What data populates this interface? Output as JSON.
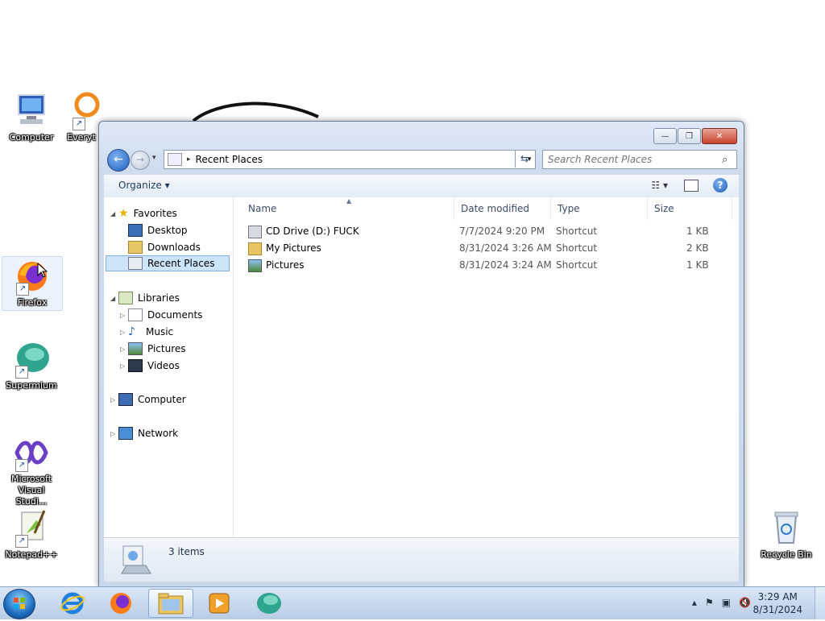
{
  "desktop": {
    "icons": [
      {
        "label": "Computer"
      },
      {
        "label": "Everyt"
      },
      {
        "label": "Firefox"
      },
      {
        "label": "Supermium"
      },
      {
        "label": "Microsoft Visual Studi..."
      },
      {
        "label": "Notepad++"
      },
      {
        "label": "Recycle Bin"
      }
    ]
  },
  "window": {
    "caption_buttons": {
      "minimize": "—",
      "maximize": "❐",
      "close": "✕"
    },
    "nav": {
      "back": "←",
      "forward": "→",
      "history": "▾"
    },
    "address": {
      "path": "Recent Places",
      "separator": "▸",
      "dropdown": "▾",
      "refresh": "⇆"
    },
    "search": {
      "placeholder": "Search Recent Places"
    },
    "commandbar": {
      "organize": "Organize ▾",
      "views": "☷ ▾",
      "help": "?"
    },
    "navpane": {
      "favorites": "Favorites",
      "desktop": "Desktop",
      "downloads": "Downloads",
      "recent_places": "Recent Places",
      "libraries": "Libraries",
      "documents": "Documents",
      "music": "Music",
      "pictures": "Pictures",
      "videos": "Videos",
      "computer": "Computer",
      "network": "Network"
    },
    "columns": {
      "name": "Name",
      "date_modified": "Date modified",
      "type": "Type",
      "size": "Size"
    },
    "files": [
      {
        "name": "CD Drive (D:) FUCK",
        "date": "7/7/2024 9:20 PM",
        "type": "Shortcut",
        "size": "1 KB"
      },
      {
        "name": "My Pictures",
        "date": "8/31/2024 3:26 AM",
        "type": "Shortcut",
        "size": "2 KB"
      },
      {
        "name": "Pictures",
        "date": "8/31/2024 3:24 AM",
        "type": "Shortcut",
        "size": "1 KB"
      }
    ],
    "status": {
      "items": "3 items"
    }
  },
  "taskbar": {
    "clock": {
      "time": "3:29 AM",
      "date": "8/31/2024"
    },
    "tray": {
      "chevron": "▴",
      "flag": "⚑",
      "network": "▣",
      "volume": "🔇"
    }
  }
}
